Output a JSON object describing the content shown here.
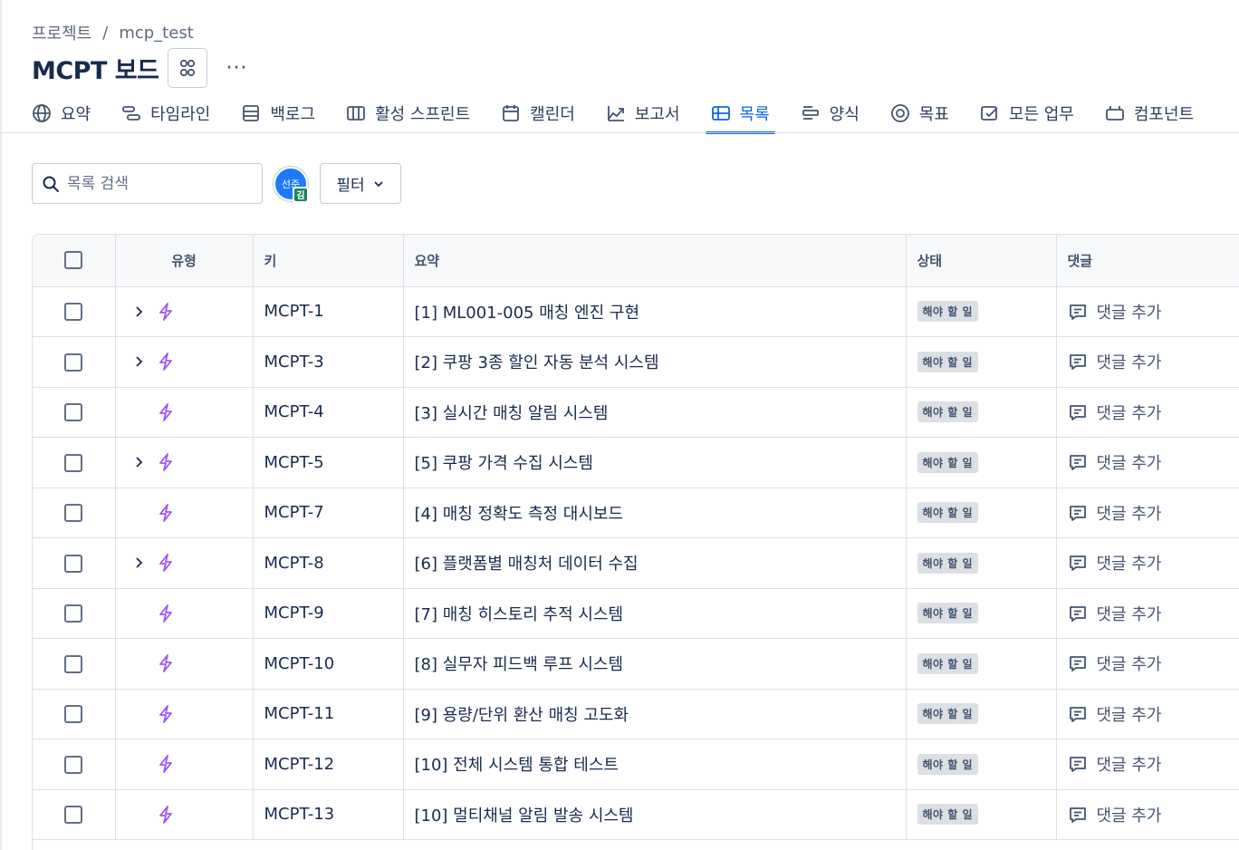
{
  "breadcrumb": {
    "project": "프로젝트",
    "separator": "/",
    "name": "mcp_test"
  },
  "header": {
    "title": "MCPT 보드",
    "more": "···"
  },
  "tabs": [
    {
      "label": "요약",
      "icon": "globe-icon"
    },
    {
      "label": "타임라인",
      "icon": "timeline-icon"
    },
    {
      "label": "백로그",
      "icon": "backlog-icon"
    },
    {
      "label": "활성 스프린트",
      "icon": "board-icon"
    },
    {
      "label": "캘린더",
      "icon": "calendar-icon"
    },
    {
      "label": "보고서",
      "icon": "chart-icon"
    },
    {
      "label": "목록",
      "icon": "list-icon",
      "active": true
    },
    {
      "label": "양식",
      "icon": "form-icon"
    },
    {
      "label": "목표",
      "icon": "target-icon"
    },
    {
      "label": "모든 업무",
      "icon": "check-icon"
    },
    {
      "label": "컴포넌트",
      "icon": "component-icon"
    }
  ],
  "search": {
    "placeholder": "목록 검색"
  },
  "avatar": {
    "text": "선준",
    "badge": "김"
  },
  "filter": {
    "label": "필터"
  },
  "table": {
    "headers": {
      "type": "유형",
      "key": "키",
      "summary": "요약",
      "status": "상태",
      "comments": "댓글"
    },
    "rows": [
      {
        "key": "MCPT-1",
        "summary": "[1] ML001-005 매칭 엔진 구현",
        "status": "해야 할 일",
        "comment": "댓글 추가",
        "expandable": true
      },
      {
        "key": "MCPT-3",
        "summary": "[2] 쿠팡 3종 할인 자동 분석 시스템",
        "status": "해야 할 일",
        "comment": "댓글 추가",
        "expandable": true
      },
      {
        "key": "MCPT-4",
        "summary": "[3] 실시간 매칭 알림 시스템",
        "status": "해야 할 일",
        "comment": "댓글 추가",
        "expandable": false
      },
      {
        "key": "MCPT-5",
        "summary": "[5] 쿠팡 가격 수집 시스템",
        "status": "해야 할 일",
        "comment": "댓글 추가",
        "expandable": true
      },
      {
        "key": "MCPT-7",
        "summary": "[4] 매칭 정확도 측정 대시보드",
        "status": "해야 할 일",
        "comment": "댓글 추가",
        "expandable": false
      },
      {
        "key": "MCPT-8",
        "summary": "[6] 플랫폼별 매칭처 데이터 수집",
        "status": "해야 할 일",
        "comment": "댓글 추가",
        "expandable": true
      },
      {
        "key": "MCPT-9",
        "summary": "[7] 매칭 히스토리 추적 시스템",
        "status": "해야 할 일",
        "comment": "댓글 추가",
        "expandable": false
      },
      {
        "key": "MCPT-10",
        "summary": "[8] 실무자 피드백 루프 시스템",
        "status": "해야 할 일",
        "comment": "댓글 추가",
        "expandable": false
      },
      {
        "key": "MCPT-11",
        "summary": "[9] 용량/단위 환산 매칭 고도화",
        "status": "해야 할 일",
        "comment": "댓글 추가",
        "expandable": false
      },
      {
        "key": "MCPT-12",
        "summary": "[10] 전체 시스템 통합 테스트",
        "status": "해야 할 일",
        "comment": "댓글 추가",
        "expandable": false
      },
      {
        "key": "MCPT-13",
        "summary": "[10] 멀티채널 알림 발송 시스템",
        "status": "해야 할 일",
        "comment": "댓글 추가",
        "expandable": false
      }
    ]
  },
  "colors": {
    "accent": "#0c66e4",
    "epic": "#a054f7",
    "status_bg": "#dcdfe4"
  }
}
